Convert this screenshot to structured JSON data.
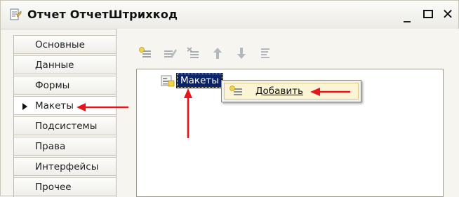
{
  "window": {
    "title": "Отчет ОтчетШтрихкод",
    "minimize_glyph": "_",
    "close_glyph": "✕"
  },
  "sidebar": {
    "items": [
      {
        "label": "Основные",
        "active": false
      },
      {
        "label": "Данные",
        "active": false
      },
      {
        "label": "Формы",
        "active": false
      },
      {
        "label": "Макеты",
        "active": true
      },
      {
        "label": "Подсистемы",
        "active": false
      },
      {
        "label": "Права",
        "active": false
      },
      {
        "label": "Интерфейсы",
        "active": false
      },
      {
        "label": "Прочее",
        "active": false
      }
    ]
  },
  "toolbar": {
    "buttons": [
      "add-icon",
      "edit-icon",
      "delete-icon",
      "move-up-icon",
      "move-down-icon",
      "sort-icon"
    ]
  },
  "tree": {
    "selected_node": "Макеты"
  },
  "context_menu": {
    "items": [
      {
        "label": "Добавить"
      }
    ]
  },
  "colors": {
    "selection": "#0a246a",
    "annotation_arrow": "#e8141b",
    "menu_highlight": "#fbf5d6"
  }
}
